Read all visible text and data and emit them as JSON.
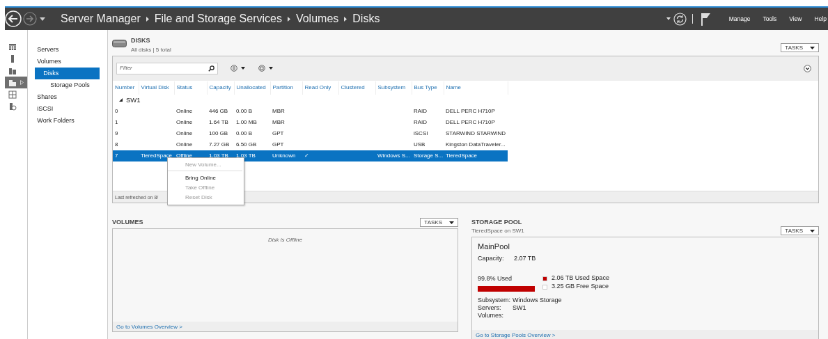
{
  "header": {
    "breadcrumb": [
      "Server Manager",
      "File and Storage Services",
      "Volumes",
      "Disks"
    ],
    "menu": [
      "Manage",
      "Tools",
      "View",
      "Help"
    ]
  },
  "rail": [
    {
      "selected": false
    },
    {
      "selected": false
    },
    {
      "selected": false
    },
    {
      "selected": true
    },
    {
      "selected": false
    },
    {
      "selected": false
    }
  ],
  "nav": [
    {
      "label": "Servers",
      "selected": false
    },
    {
      "label": "Volumes",
      "selected": false,
      "children": [
        {
          "label": "Disks",
          "selected": true
        },
        {
          "label": "Storage Pools",
          "selected": false
        }
      ]
    },
    {
      "label": "Shares",
      "selected": false
    },
    {
      "label": "iSCSI",
      "selected": false
    },
    {
      "label": "Work Folders",
      "selected": false
    }
  ],
  "disks": {
    "title": "DISKS",
    "subtitle": "All disks | 5 total",
    "tasks": "TASKS",
    "filter": {
      "placeholder": "Filter"
    },
    "columns": [
      "Number",
      "Virtual Disk",
      "Status",
      "Capacity",
      "Unallocated",
      "Partition",
      "Read Only",
      "Clustered",
      "Subsystem",
      "Bus Type",
      "Name"
    ],
    "group": "SW1",
    "rows": [
      {
        "cells": [
          "0",
          "",
          "Online",
          "446 GB",
          "0.00 B",
          "MBR",
          "",
          "",
          "",
          "RAID",
          "DELL PERC H710P"
        ],
        "selected": false
      },
      {
        "cells": [
          "1",
          "",
          "Online",
          "1.64 TB",
          "1.00 MB",
          "MBR",
          "",
          "",
          "",
          "RAID",
          "DELL PERC H710P"
        ],
        "selected": false
      },
      {
        "cells": [
          "9",
          "",
          "Online",
          "100 GB",
          "0.00 B",
          "GPT",
          "",
          "",
          "",
          "iSCSI",
          "STARWIND STARWIND"
        ],
        "selected": false
      },
      {
        "cells": [
          "8",
          "",
          "Online",
          "7.27 GB",
          "6.50 GB",
          "GPT",
          "",
          "",
          "",
          "USB",
          "Kingston DataTraveler..."
        ],
        "selected": false
      },
      {
        "cells": [
          "7",
          "TieredSpace",
          "Offline",
          "1.03 TB",
          "1.03 TB",
          "Unknown",
          "✓",
          "",
          "Windows S...",
          "Storage S...",
          "TieredSpace"
        ],
        "selected": true
      }
    ],
    "footer": "Last refreshed on 8/",
    "context_menu": [
      {
        "label": "New Volume...",
        "disabled": true,
        "separator_after": true
      },
      {
        "label": "Bring Online",
        "disabled": false,
        "separator_after": false
      },
      {
        "label": "Take Offline",
        "disabled": true,
        "separator_after": false
      },
      {
        "label": "Reset Disk",
        "disabled": true,
        "separator_after": false
      }
    ]
  },
  "volumes": {
    "title": "VOLUMES",
    "tasks": "TASKS",
    "message": "Disk is Offline",
    "link": "Go to Volumes Overview >"
  },
  "storage_pool": {
    "title": "STORAGE POOL",
    "subtitle": "TieredSpace on SW1",
    "tasks": "TASKS",
    "name": "MainPool",
    "capacity": {
      "label": "Capacity:",
      "value": "2.07 TB"
    },
    "used_label": "99.8% Used",
    "level": 0.998,
    "legend": [
      {
        "text": "2.06 TB Used Space",
        "color": "#c00000"
      },
      {
        "text": "3.25 GB Free Space",
        "color": "#ffffff"
      }
    ],
    "details": [
      {
        "label": "Subsystem:",
        "value": "Windows Storage"
      },
      {
        "label": "Servers:",
        "value": "SW1"
      },
      {
        "label": "Volumes:"
      }
    ],
    "link": "Go to Storage Pools Overview >"
  }
}
